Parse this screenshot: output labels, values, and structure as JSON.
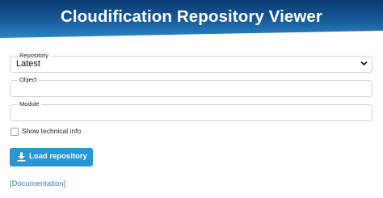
{
  "header": {
    "title": "Cloudification Repository Viewer"
  },
  "form": {
    "repository": {
      "label": "Repository",
      "value": "Latest"
    },
    "object": {
      "label": "Object",
      "value": ""
    },
    "module": {
      "label": "Module",
      "value": ""
    },
    "technical_info": {
      "label": "Show technical info",
      "checked": false
    }
  },
  "actions": {
    "load_label": "Load repository"
  },
  "footer": {
    "documentation_link": "[Documentation]"
  },
  "colors": {
    "header_dark": "#0b3b73",
    "header_mid": "#185c9b",
    "header_light": "#2a86c6",
    "button": "#2a96d3",
    "link": "#3b7fc4"
  }
}
